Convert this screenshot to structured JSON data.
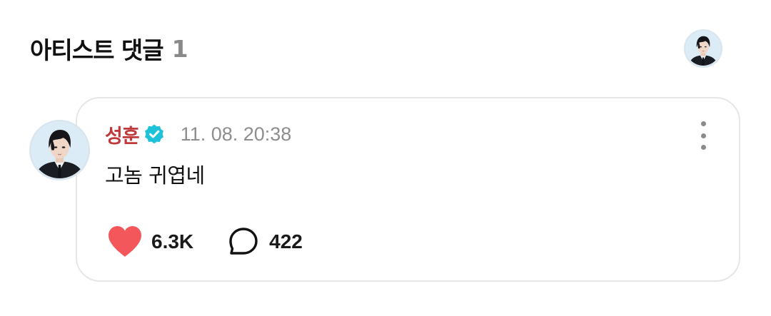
{
  "header": {
    "title": "아티스트 댓글",
    "count": "1",
    "avatar_icon": "artist-avatar"
  },
  "comment": {
    "author": "성훈",
    "verified_icon": "verified-badge-icon",
    "timestamp": "11. 08. 20:38",
    "text": "고놈 귀엽네",
    "more_icon": "more-vertical-icon",
    "likes": "6.3K",
    "like_icon": "heart-icon",
    "replies": "422",
    "reply_icon": "comment-bubble-icon"
  },
  "colors": {
    "author_name": "#c0393b",
    "verified_badge": "#1ec2d8",
    "heart": "#f4575b",
    "muted_text": "#8e8e8e",
    "card_border": "#e6e6e6"
  }
}
